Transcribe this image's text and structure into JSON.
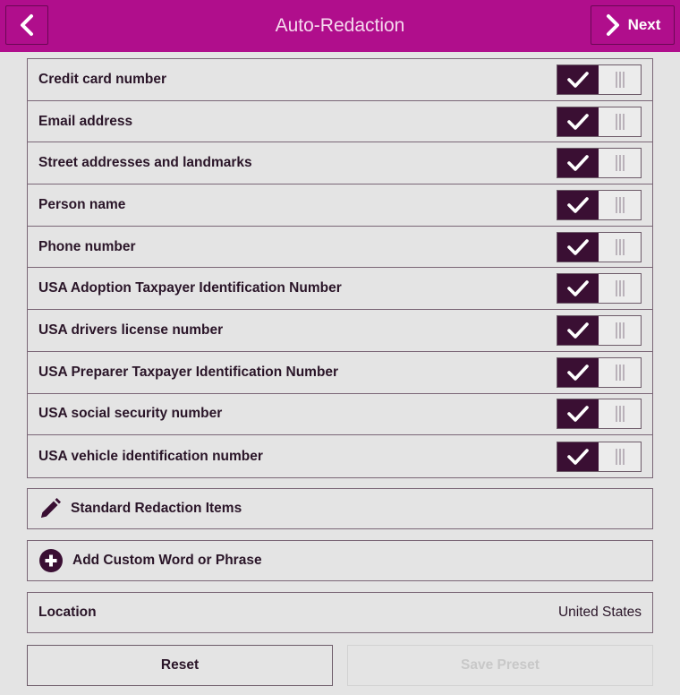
{
  "header": {
    "title": "Auto-Redaction",
    "back_icon": "chevron-left-icon",
    "next_label": "Next",
    "next_icon": "chevron-right-icon"
  },
  "colors": {
    "header_bg": "#b00e8c",
    "toggle_on": "#3a0f33",
    "background": "#e4e4e4"
  },
  "redaction_items": [
    {
      "label": "Credit card number",
      "enabled": true
    },
    {
      "label": "Email address",
      "enabled": true
    },
    {
      "label": "Street addresses and landmarks",
      "enabled": true
    },
    {
      "label": "Person name",
      "enabled": true
    },
    {
      "label": "Phone number",
      "enabled": true
    },
    {
      "label": "USA Adoption Taxpayer Identification Number",
      "enabled": true
    },
    {
      "label": "USA drivers license number",
      "enabled": true
    },
    {
      "label": "USA Preparer Taxpayer Identification Number",
      "enabled": true
    },
    {
      "label": "USA social security number",
      "enabled": true
    },
    {
      "label": "USA vehicle identification number",
      "enabled": true
    }
  ],
  "standard_items": {
    "label": "Standard Redaction Items",
    "icon": "pencil-icon"
  },
  "custom_word": {
    "label": "Add Custom Word or Phrase",
    "icon": "plus-circle-icon"
  },
  "location": {
    "label": "Location",
    "value": "United States"
  },
  "actions": {
    "reset_label": "Reset",
    "save_preset_label": "Save Preset",
    "save_preset_enabled": false
  }
}
